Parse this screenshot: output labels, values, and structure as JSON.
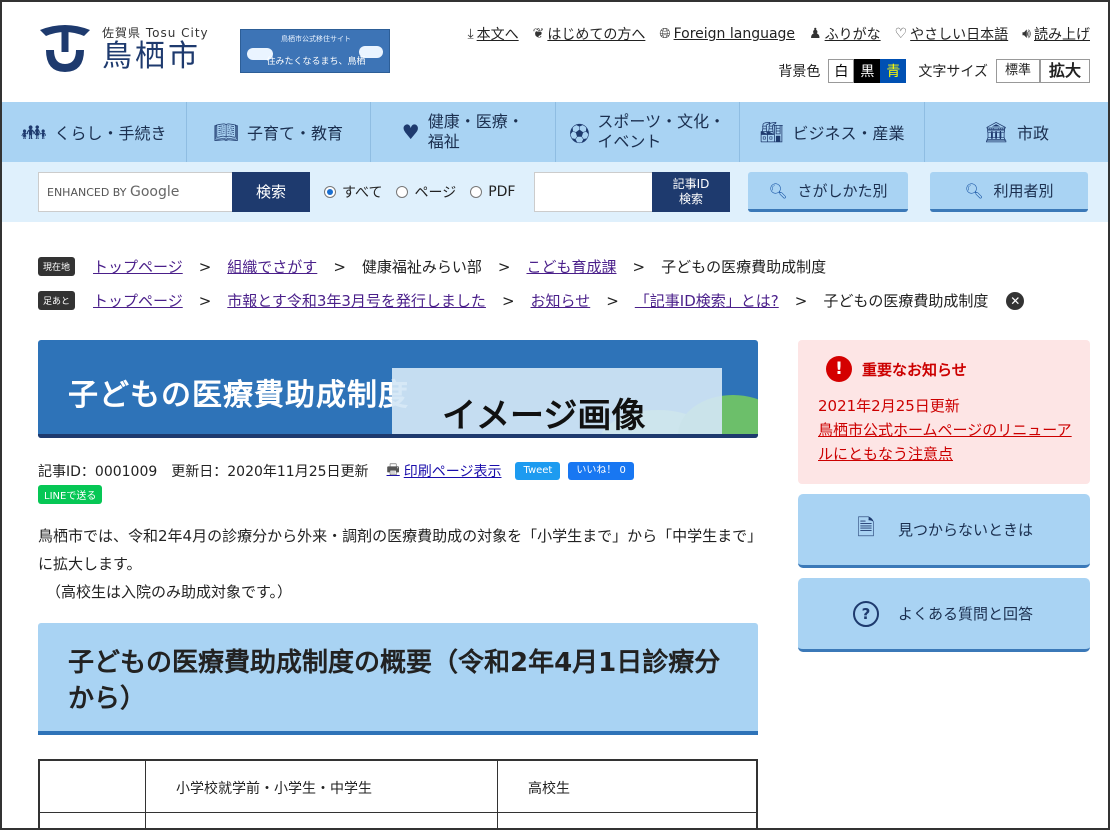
{
  "header": {
    "prefecture_label": "佐賀県 Tosu City",
    "city_name": "鳥栖市",
    "banner_top": "鳥栖市公式移住サイト",
    "banner_main": "住みたくなるまち、鳥栖",
    "utility_links": [
      {
        "icon": "download-icon",
        "label": "本文へ"
      },
      {
        "icon": "leaf-icon",
        "label": "はじめての方へ"
      },
      {
        "icon": "globe-icon",
        "label": "Foreign language"
      },
      {
        "icon": "family-icon",
        "label": "ふりがな"
      },
      {
        "icon": "heart-icon",
        "label": "やさしい日本語"
      },
      {
        "icon": "speaker-icon",
        "label": "読み上げ"
      }
    ],
    "background_label": "背景色",
    "background_options": [
      "白",
      "黒",
      "青"
    ],
    "font_size_label": "文字サイズ",
    "font_size_options": [
      "標準",
      "拡大"
    ]
  },
  "nav": {
    "items": [
      {
        "icon": "people-icon",
        "label": "くらし・手続き"
      },
      {
        "icon": "book-icon",
        "label": "子育て・教育"
      },
      {
        "icon": "heart-icon",
        "label": "健康・医療・\n福祉"
      },
      {
        "icon": "ball-icon",
        "label": "スポーツ・文化・\nイベント"
      },
      {
        "icon": "factory-icon",
        "label": "ビジネス・産業"
      },
      {
        "icon": "building-icon",
        "label": "市政"
      }
    ]
  },
  "search": {
    "placeholder_prefix": "ENHANCED BY",
    "placeholder_brand": "Google",
    "button_label": "検索",
    "scope_options": [
      "すべて",
      "ページ",
      "PDF"
    ],
    "scope_selected": "すべて",
    "article_id_button_line1": "記事ID",
    "article_id_button_line2": "検索",
    "how_to_search_label": "さがしかた別",
    "by_user_label": "利用者別"
  },
  "breadcrumbs": {
    "location_tag": "現在地",
    "location": [
      "トップページ",
      "組織でさがす",
      "健康福祉みらい部",
      "こども育成課",
      "子どもの医療費助成制度"
    ],
    "history_tag": "足あと",
    "history": [
      "トップページ",
      "市報とす令和3年3月号を発行しました",
      "お知らせ",
      "「記事ID検索」とは?",
      "子どもの医療費助成制度"
    ]
  },
  "article": {
    "title": "子どもの医療費助成制度",
    "image_placeholder": "イメージ画像",
    "article_id": "記事ID：0001009",
    "updated": "更新日：2020年11月25日更新",
    "print_label": "印刷ページ表示",
    "tweet_label": "Tweet",
    "like_label": "いいね！ 0",
    "line_label": "LINEで送る",
    "intro": "鳥栖市では、令和2年4月の診療分から外来・調剤の医療費助成の対象を「小学生まで」から「中学生まで」に拡大します。",
    "intro_note": "（高校生は入院のみ助成対象です。）",
    "section_heading": "子どもの医療費助成制度の概要（令和2年4月1日診療分から）",
    "table_headers": [
      "",
      "小学校就学前・小学生・中学生",
      "高校生"
    ]
  },
  "sidebar": {
    "notice_title": "重要なお知らせ",
    "notice_date": "2021年2月25日更新",
    "notice_link": "鳥栖市公式ホームページのリニューアルにともなう注意点",
    "help_label": "見つからないときは",
    "faq_label": "よくある質問と回答"
  },
  "colors": {
    "brand_navy": "#1e3a6e",
    "nav_blue": "#a9d3f3",
    "title_blue": "#2e73b8",
    "alert_red": "#c00000",
    "notice_bg": "#fde5e5"
  }
}
